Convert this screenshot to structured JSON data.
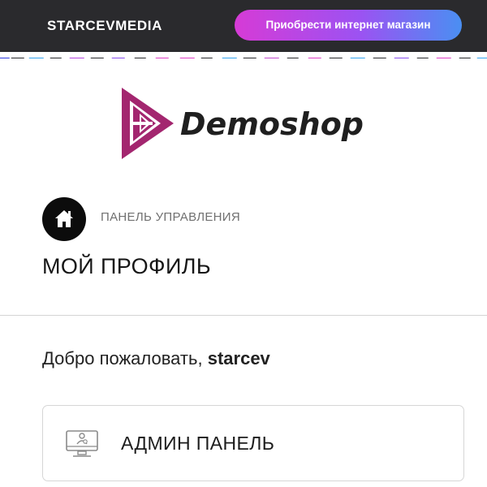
{
  "header": {
    "brand": "STARCEVMEDIA",
    "cta_label": "Приобрести интернет магазин"
  },
  "logo": {
    "text": "Demoshop"
  },
  "breadcrumb": {
    "label": "ПАНЕЛЬ УПРАВЛЕНИЯ"
  },
  "page": {
    "title": "МОЙ ПРОФИЛЬ"
  },
  "welcome": {
    "greeting": "Добро пожаловать,",
    "username": "starcev"
  },
  "admin_card": {
    "label": "АДМИН ПАНЕЛЬ"
  },
  "icons": {
    "home": "home-icon",
    "admin": "monitor-user-icon"
  },
  "colors": {
    "header_bg": "#2a2a2d",
    "cta_start": "#d63bd6",
    "cta_end": "#4a8ff2",
    "logo_accent": "#a3266f"
  }
}
